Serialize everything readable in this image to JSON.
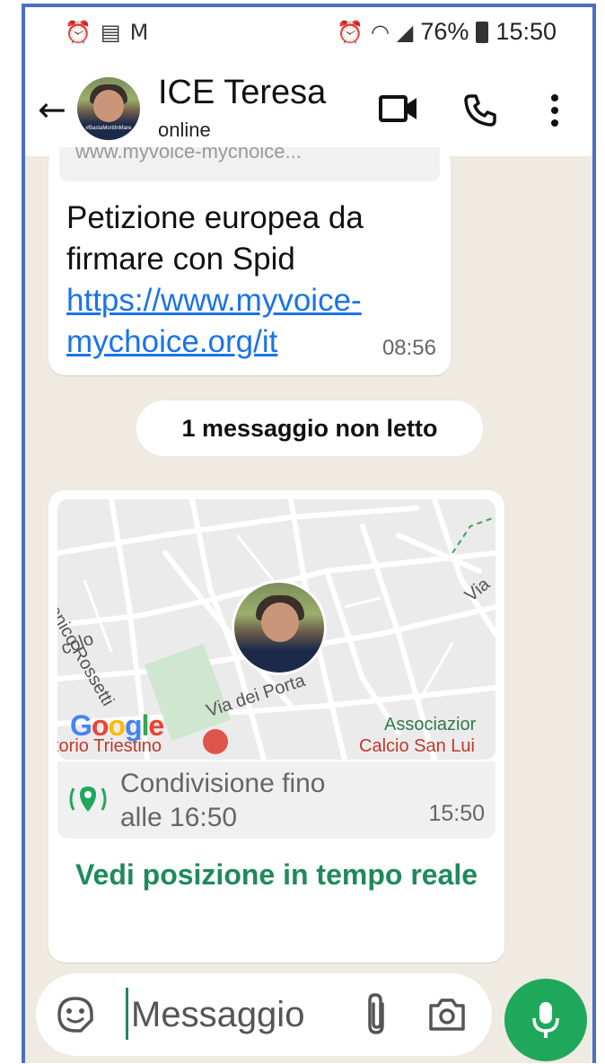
{
  "status_bar": {
    "battery_percent": "76%",
    "time": "15:50"
  },
  "header": {
    "contact_name": "ICE Teresa",
    "status": "online",
    "avatar_banner": "#BastaMortiInMare"
  },
  "messages": [
    {
      "preview_text": "www.myvoice-mychoice...",
      "text": "Petizione europea da firmare con Spid",
      "link": "https://www.myvoice-mychoice.org/it",
      "time": "08:56"
    }
  ],
  "unread_divider": "1 messaggio non letto",
  "location_message": {
    "map_labels": {
      "rossetti": "menico Rossetti",
      "colo": "colo",
      "via_porta": "Via dei Porta",
      "via": "Via",
      "assoc1": "Associazior",
      "assoc2": "Calcio San Lui",
      "ospedale": "torio Triestino"
    },
    "share_text_line1": "Condivisione fino",
    "share_text_line2": "alle 16:50",
    "time": "15:50",
    "live_button": "Vedi posizione in tempo reale"
  },
  "input": {
    "placeholder": "Messaggio"
  },
  "colors": {
    "accent": "#1f8a5b",
    "mic_button": "#1fa85b",
    "link": "#1a73e8",
    "chat_bg": "#efeae2"
  }
}
